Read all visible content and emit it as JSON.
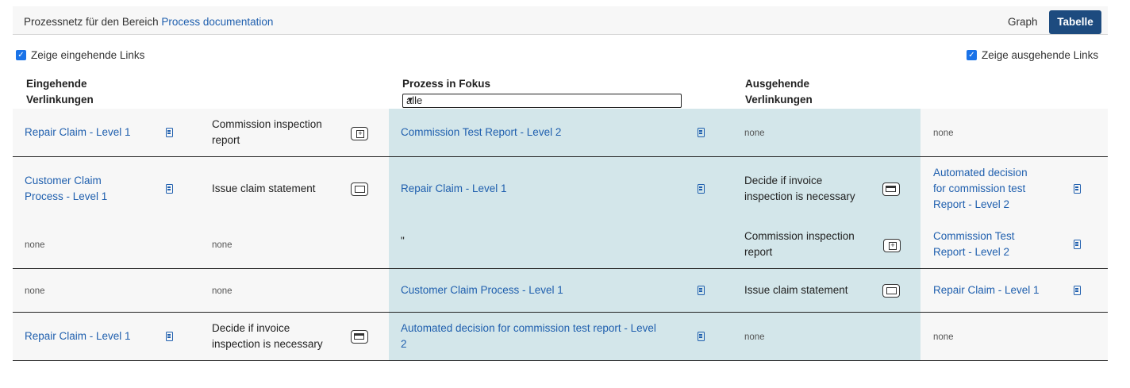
{
  "topbar": {
    "breadcrumb_prefix": "Prozessnetz für den Bereich",
    "breadcrumb_link": "Process documentation",
    "view_graph": "Graph",
    "view_table": "Tabelle"
  },
  "options": {
    "show_incoming": "Zeige eingehende Links",
    "show_outgoing": "Zeige ausgehende Links"
  },
  "headers": {
    "incoming_1": "Eingehende",
    "incoming_2": "Verlinkungen",
    "focus": "Prozess in Fokus",
    "outgoing_1": "Ausgehende",
    "outgoing_2": "Verlinkungen"
  },
  "filter": {
    "selected": "alle"
  },
  "rows": [
    {
      "in_process": "Repair Claim - Level 1",
      "in_task_1": "Commission inspection",
      "in_task_2": "report",
      "focus_1": "Commission Test Report - Level 2",
      "focus_2": "",
      "out_task_1": "none",
      "out_task_2": "",
      "out_process_1": "none",
      "out_process_2": "",
      "out_process_3": ""
    },
    {
      "in_process_1": "Customer Claim",
      "in_process_2": "Process - Level 1",
      "in_task": "Issue claim statement",
      "focus": "Repair Claim - Level 1",
      "out_task_1": "Decide if invoice",
      "out_task_2": "inspection is necessary",
      "out_process_1": "Automated decision",
      "out_process_2": "for commission test",
      "out_process_3": "Report - Level 2"
    },
    {
      "in_process": "none",
      "in_task": "none",
      "focus": "\"",
      "out_task_1": "Commission inspection",
      "out_task_2": "report",
      "out_process_1": "Commission Test",
      "out_process_2": "Report - Level 2"
    },
    {
      "in_process": "none",
      "in_task": "none",
      "focus": "Customer Claim Process - Level 1",
      "out_task": "Issue claim statement",
      "out_process": "Repair Claim - Level 1"
    },
    {
      "in_process": "Repair Claim - Level 1",
      "in_task_1": "Decide if invoice",
      "in_task_2": "inspection is necessary",
      "focus_1": "Automated decision for commission test report - Level",
      "focus_2": "2",
      "out_task": "none",
      "out_process": "none"
    }
  ]
}
